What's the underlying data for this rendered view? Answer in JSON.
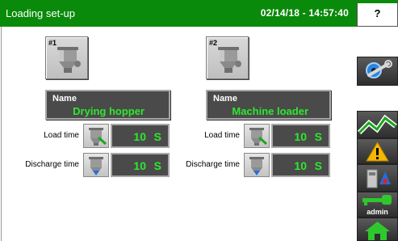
{
  "header": {
    "title": "Loading set-up",
    "datetime": "02/14/18 - 14:57:40",
    "help_label": "?"
  },
  "loaders": [
    {
      "number": "#1",
      "name_label": "Name",
      "name": "Drying hopper",
      "load_time_label": "Load time",
      "load_time": "10",
      "load_unit": "S",
      "discharge_time_label": "Discharge time",
      "discharge_time": "10",
      "discharge_unit": "S"
    },
    {
      "number": "#2",
      "name_label": "Name",
      "name": "Machine loader",
      "load_time_label": "Load time",
      "load_time": "10",
      "load_unit": "S",
      "discharge_time_label": "Discharge time",
      "discharge_time": "10",
      "discharge_unit": "S"
    }
  ],
  "sidebar": {
    "user_label": "admin"
  },
  "icons": {
    "settings": "wrench-gear-icon",
    "trend": "trend-chart-icon",
    "alarm": "warning-icon",
    "dryer": "dryer-unit-icon",
    "user": "user-key-icon",
    "home": "home-icon"
  },
  "colors": {
    "header": "#0a8a0a",
    "value_text": "#2ee82e",
    "panel": "#4a4a4a",
    "warning": "#f5b800"
  }
}
